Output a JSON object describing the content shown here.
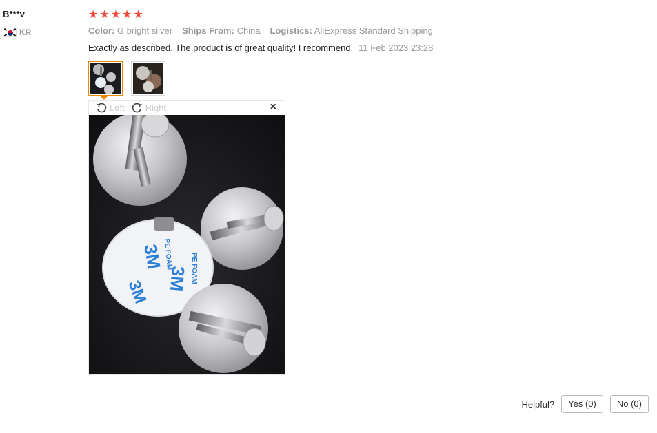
{
  "reviewer": {
    "name": "B***v",
    "country_code": "KR",
    "flag_icon": "south-korea-flag-icon"
  },
  "review": {
    "rating": 5,
    "rating_max": 5,
    "star_color": "#f44a3e",
    "meta": [
      {
        "key": "Color:",
        "value": "G bright silver"
      },
      {
        "key": "Ships From:",
        "value": "China"
      },
      {
        "key": "Logistics:",
        "value": "AliExpress Standard Shipping"
      }
    ],
    "text": "Exactly as described. The product is of great quality! I recommend.",
    "date": "11 Feb 2023 23:28"
  },
  "gallery": {
    "thumbnails": [
      {
        "name": "review-photo-1",
        "active": true
      },
      {
        "name": "review-photo-2",
        "active": false
      }
    ],
    "active_border_color": "#e68a00"
  },
  "viewer": {
    "rotate_left_label": "Left",
    "rotate_right_label": "Right",
    "close_symbol": "×"
  },
  "helpful": {
    "label": "Helpful?",
    "yes_label": "Yes (0)",
    "no_label": "No (0)"
  }
}
